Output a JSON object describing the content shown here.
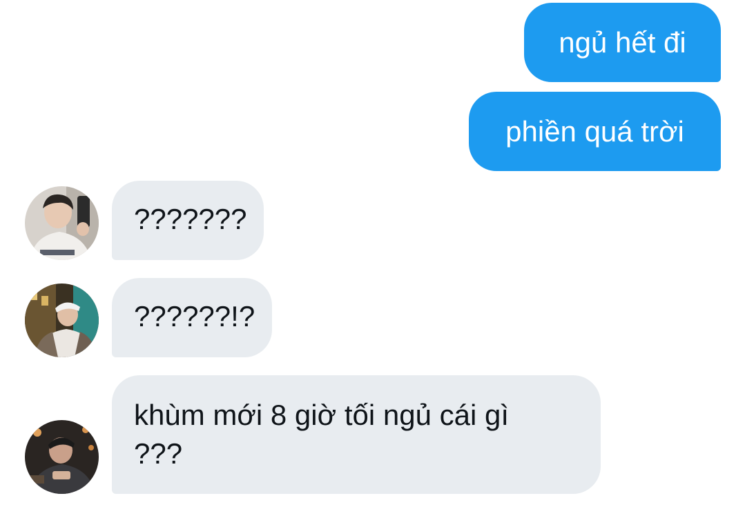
{
  "conversation": {
    "messages": [
      {
        "side": "outgoing",
        "text": "ngủ hết đi"
      },
      {
        "side": "outgoing",
        "text": "phiền quá trời"
      },
      {
        "side": "incoming",
        "text": "???????"
      },
      {
        "side": "incoming",
        "text": "??????!?"
      },
      {
        "side": "incoming",
        "text": "khùm mới 8 giờ tối ngủ cái gì ???"
      }
    ]
  },
  "colors": {
    "outgoing_bubble": "#1d9bf0",
    "incoming_bubble": "#e8ecf0",
    "outgoing_text": "#ffffff",
    "incoming_text": "#0f1419"
  },
  "icons": [
    "user-avatar-1",
    "user-avatar-2",
    "user-avatar-3"
  ]
}
